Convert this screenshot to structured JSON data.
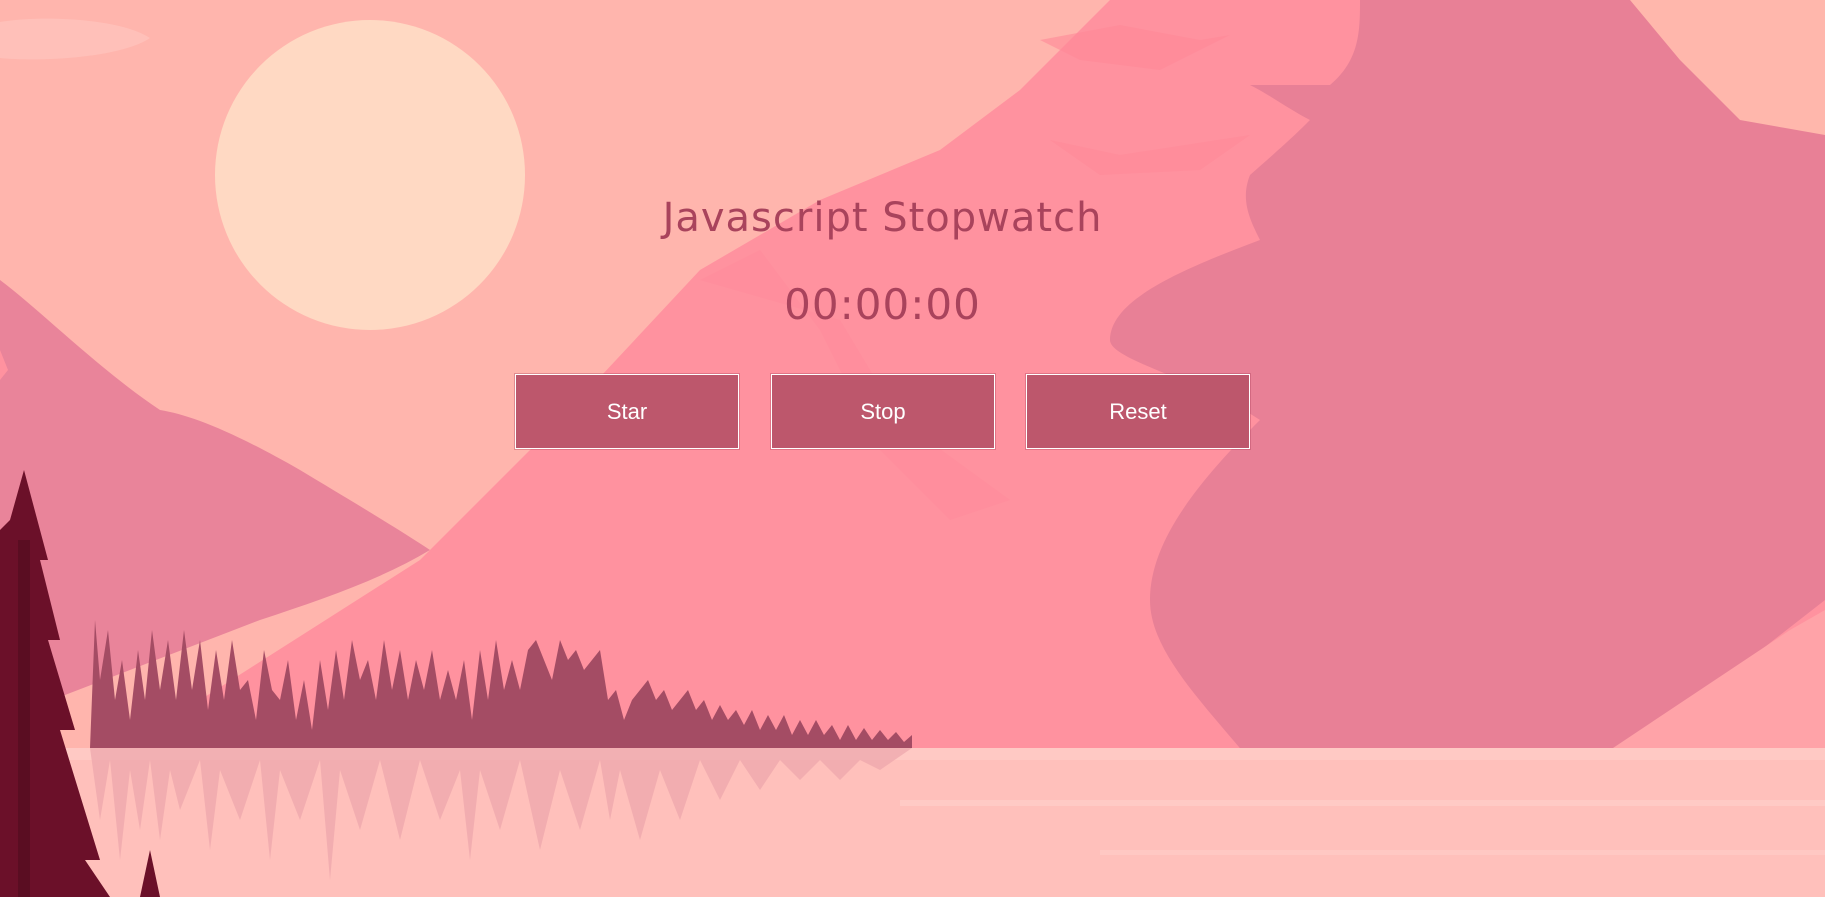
{
  "app": {
    "title": "Javascript Stopwatch",
    "timer_display": "00:00:00"
  },
  "controls": {
    "start_label": "Star",
    "stop_label": "Stop",
    "reset_label": "Reset"
  },
  "colors": {
    "sky": "#ffb5ad",
    "sun": "#ffd9c3",
    "mountain_mid": "#ff929f",
    "mountain_dark": "#e88096",
    "mountain_left": "#e9849a",
    "lake": "#ffc0bb",
    "forest": "#a44c64",
    "tree_dark": "#6b1029",
    "title_text": "#a9435c",
    "button_bg": "#bd576c",
    "button_text": "#ffffff"
  },
  "background": {
    "description_icon": "mountain-landscape-illustration"
  }
}
